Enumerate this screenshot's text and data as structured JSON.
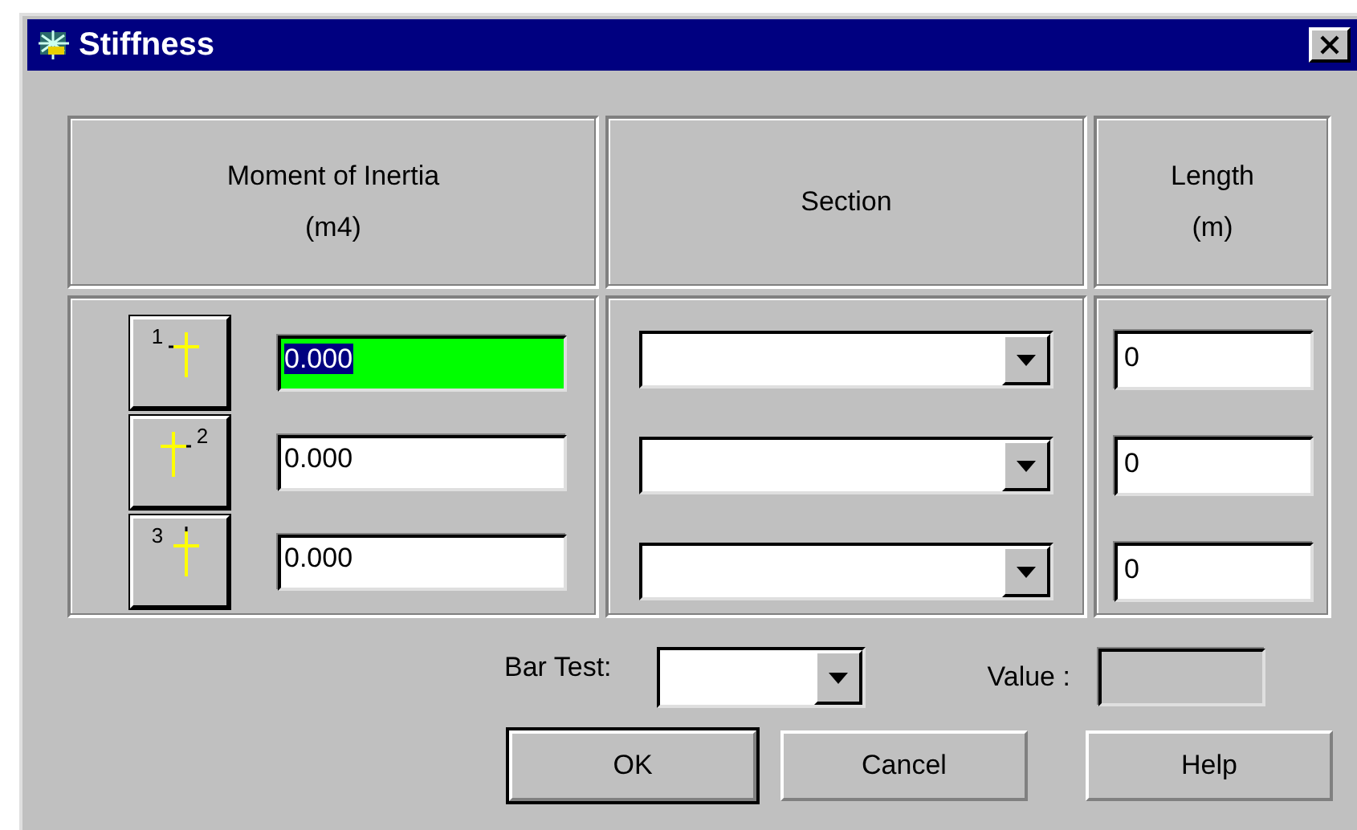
{
  "window": {
    "title": "Stiffness"
  },
  "columns": [
    {
      "title": "Moment of Inertia",
      "unit": "(m4)"
    },
    {
      "title": "Section"
    },
    {
      "title": "Length",
      "unit": "(m)"
    }
  ],
  "rows": [
    {
      "axis_button": {
        "label": "1",
        "kind": "left"
      },
      "inertia": {
        "value": "0.000",
        "highlighted": true
      },
      "length": "0"
    },
    {
      "axis_button": {
        "label": "2",
        "kind": "right"
      },
      "inertia": {
        "value": "0.000",
        "highlighted": false
      },
      "length": "0"
    },
    {
      "axis_button": {
        "label": "3",
        "kind": "top"
      },
      "inertia": {
        "value": "0.000",
        "highlighted": false
      },
      "length": "0"
    }
  ],
  "bar_test": {
    "label": "Bar Test:"
  },
  "value_field": {
    "label": "Value :",
    "disabled": true
  },
  "buttons": [
    {
      "label": "OK",
      "default": true
    },
    {
      "label": "Cancel",
      "default": false
    },
    {
      "label": "Help",
      "default": false
    }
  ]
}
